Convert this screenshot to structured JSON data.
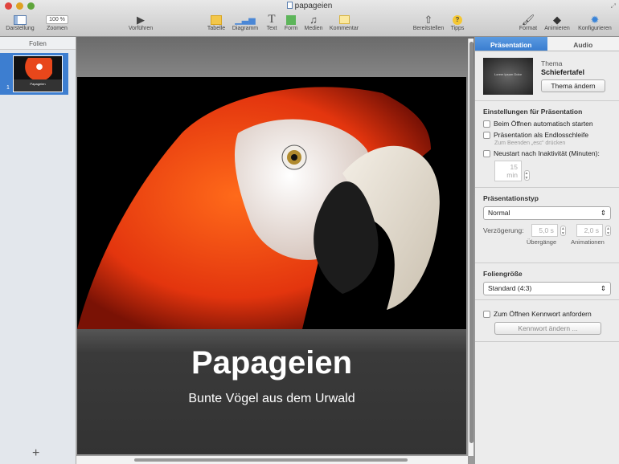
{
  "window": {
    "title": "papageien"
  },
  "toolbar": {
    "darstellung": "Darstellung",
    "zoom_value": "100 %",
    "zoomen": "Zoomen",
    "vorfuehren": "Vorführen",
    "tabelle": "Tabelle",
    "diagramm": "Diagramm",
    "text": "Text",
    "form": "Form",
    "medien": "Medien",
    "kommentar": "Kommentar",
    "bereitstellen": "Bereitstellen",
    "tipps": "Tipps",
    "format": "Format",
    "animieren": "Animieren",
    "konfigurieren": "Konfigurieren"
  },
  "sidebar": {
    "header": "Folien",
    "slides": [
      {
        "number": "1",
        "title": "Papageien"
      }
    ]
  },
  "slide": {
    "title": "Papageien",
    "subtitle": "Bunte Vögel aus dem Urwald"
  },
  "panel": {
    "tabs": [
      "Präsentation",
      "Audio"
    ],
    "theme_label": "Thema",
    "theme_name": "Schiefertafel",
    "theme_thumb_text": "Lorem Ipsum Dolor",
    "change_theme": "Thema ändern",
    "settings_header": "Einstellungen für Präsentation",
    "autostart": "Beim Öffnen automatisch starten",
    "loop": "Präsentation als Endlosschleife",
    "loop_hint": "Zum Beenden „esc“ drücken",
    "restart": "Neustart nach Inaktivität (Minuten):",
    "restart_value": "15 min",
    "type_header": "Präsentationstyp",
    "type_value": "Normal",
    "delay_label": "Verzögerung:",
    "transitions_value": "5,0 s",
    "transitions_label": "Übergänge",
    "animations_value": "2,0 s",
    "animations_label": "Animationen",
    "size_header": "Foliengröße",
    "size_value": "Standard (4:3)",
    "password": "Zum Öffnen Kennwort anfordern",
    "change_password": "Kennwort ändern ..."
  },
  "colors": {
    "accent": "#3a7dd0"
  }
}
